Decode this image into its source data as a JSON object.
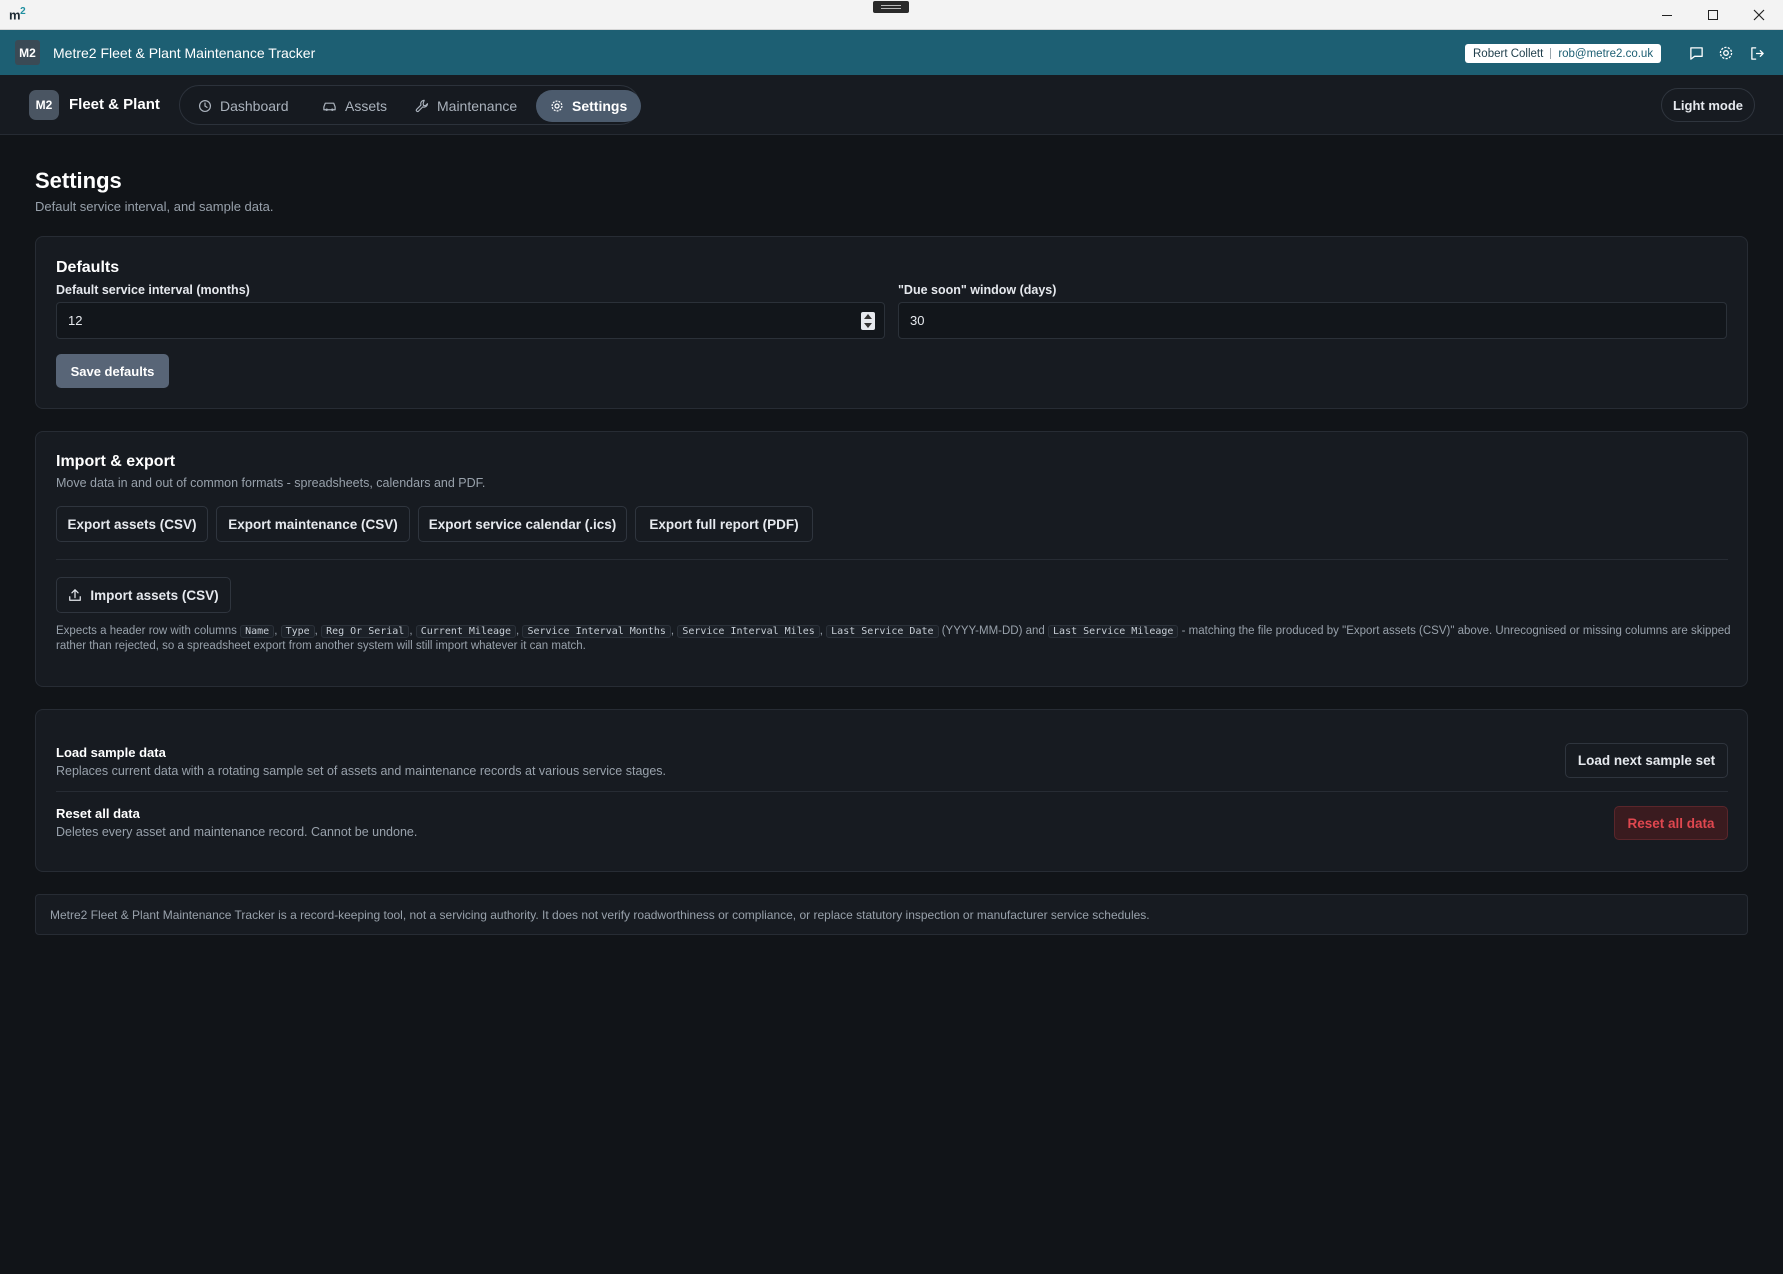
{
  "os": {
    "logo_text": "m",
    "logo_sup": "2"
  },
  "header": {
    "badge": "M2",
    "title": "Metre2 Fleet & Plant Maintenance Tracker",
    "user_name": "Robert Collett",
    "user_email": "rob@metre2.co.uk",
    "icons": [
      "chat-icon",
      "settings-icon",
      "logout-icon"
    ]
  },
  "nav": {
    "brand_badge": "M2",
    "brand_name": "Fleet & Plant",
    "tabs": [
      {
        "label": "Dashboard",
        "icon": "clock-icon",
        "active": false
      },
      {
        "label": "Assets",
        "icon": "car-icon",
        "active": false
      },
      {
        "label": "Maintenance",
        "icon": "wrench-icon",
        "active": false
      },
      {
        "label": "Settings",
        "icon": "gear-icon",
        "active": true
      }
    ],
    "theme_toggle": "Light mode"
  },
  "page": {
    "title": "Settings",
    "subtitle": "Default service interval, and sample data."
  },
  "defaults": {
    "title": "Defaults",
    "interval_label": "Default service interval (months)",
    "interval_value": "12",
    "due_soon_label": "\"Due soon\" window (days)",
    "due_soon_value": "30",
    "save_label": "Save defaults"
  },
  "import_export": {
    "title": "Import & export",
    "subtitle": "Move data in and out of common formats - spreadsheets, calendars and PDF.",
    "buttons": [
      "Export assets (CSV)",
      "Export maintenance (CSV)",
      "Export service calendar (.ics)",
      "Export full report (PDF)"
    ],
    "import_label": "Import assets (CSV)",
    "help_prefix": "Expects a header row with columns",
    "columns": [
      "Name",
      "Type",
      "Reg Or Serial",
      "Current Mileage",
      "Service Interval Months",
      "Service Interval Miles",
      "Last Service Date"
    ],
    "date_format": "(YYYY-MM-DD) and",
    "last_column": "Last Service Mileage",
    "help_suffix": "- matching the file produced by \"Export assets (CSV)\" above. Unrecognised or missing columns are skipped rather than rejected, so a spreadsheet export from another system will still import whatever it can match."
  },
  "sample": {
    "load_title": "Load sample data",
    "load_desc": "Replaces current data with a rotating sample set of assets and maintenance records at various service stages.",
    "load_button": "Load next sample set",
    "reset_title": "Reset all data",
    "reset_desc": "Deletes every asset and maintenance record. Cannot be undone.",
    "reset_button": "Reset all data"
  },
  "disclaimer": "Metre2 Fleet & Plant Maintenance Tracker is a record-keeping tool, not a servicing authority. It does not verify roadworthiness or compliance, or replace statutory inspection or manufacturer service schedules.",
  "colors": {
    "header_bg": "#1d5f73",
    "page_bg": "#111418",
    "card_bg": "#171b21",
    "active_tab": "#4c5b6d",
    "primary_button": "#586577",
    "danger_text": "#e0474f"
  }
}
